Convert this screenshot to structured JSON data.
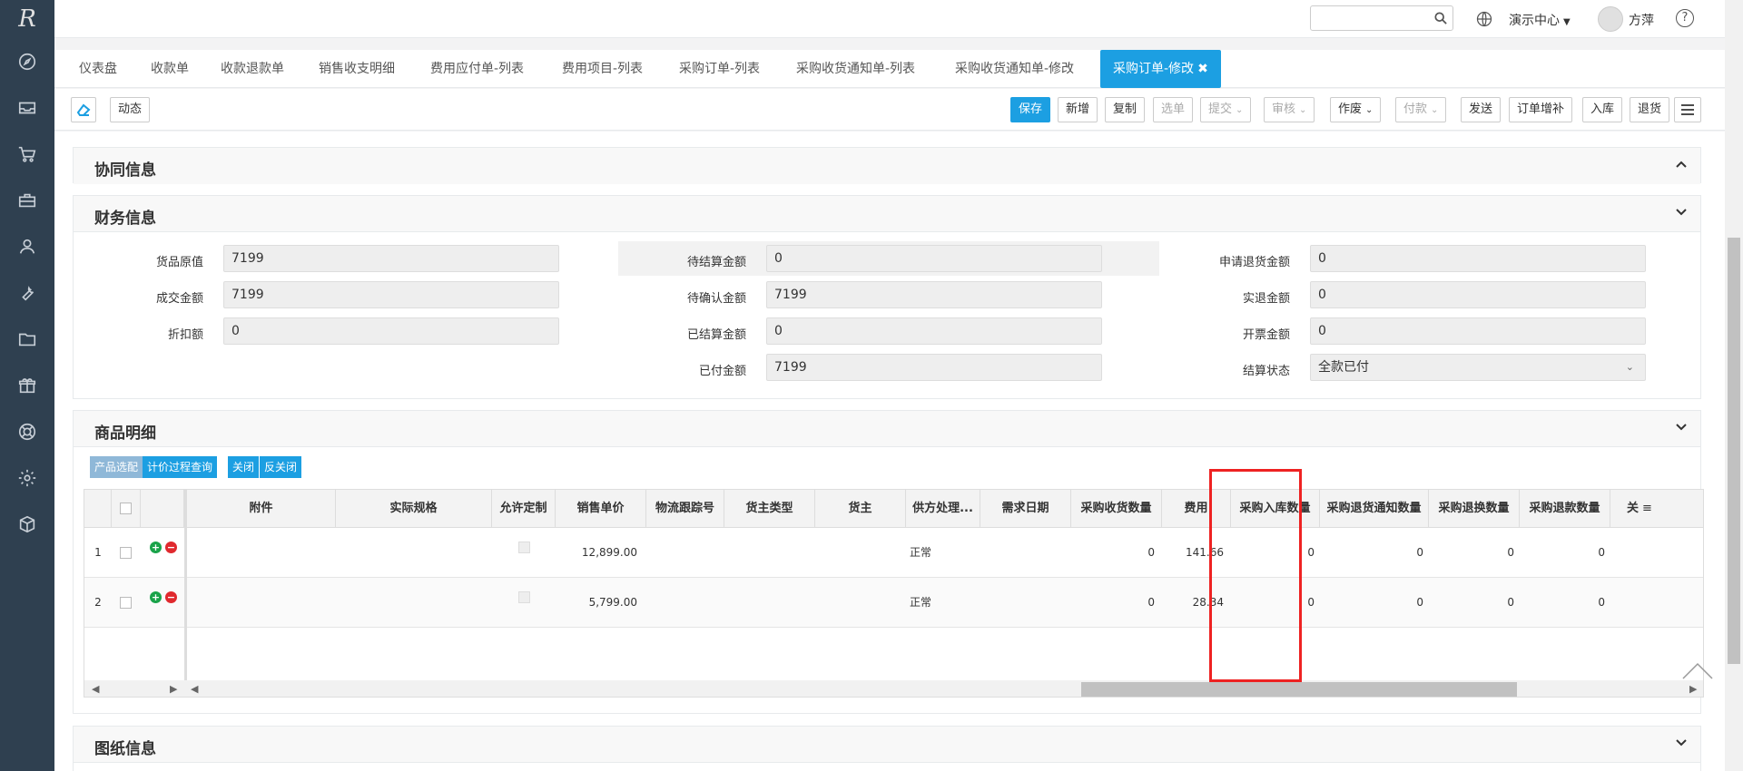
{
  "app": {
    "logo_text": "R",
    "user": "方萍",
    "center_menu": "演示中心",
    "search_placeholder": ""
  },
  "sidebar_icons": [
    "compass-icon",
    "inbox-icon",
    "cart-icon",
    "briefcase-icon",
    "user-icon",
    "wrench-icon",
    "folder-icon",
    "gift-icon",
    "lifebuoy-icon",
    "gear-icon",
    "cube-icon"
  ],
  "tabs": [
    "仪表盘",
    "收款单",
    "收款退款单",
    "销售收支明细",
    "费用应付单-列表",
    "费用项目-列表",
    "采购订单-列表",
    "采购收货通知单-列表",
    "采购收货通知单-修改",
    "采购订单-修改"
  ],
  "active_tab_index": 9,
  "toolbar": {
    "dynamic": "动态",
    "save": "保存",
    "add": "新增",
    "copy": "复制",
    "select": "选单",
    "submit": "提交",
    "audit": "审核",
    "void": "作废",
    "payment": "付款",
    "send": "发送",
    "order_supplement": "订单增补",
    "warehouse_in": "入库",
    "return": "退货"
  },
  "sections": {
    "collab": "协同信息",
    "finance": "财务信息",
    "goods": "商品明细",
    "drawings": "图纸信息"
  },
  "finance": {
    "col1": [
      {
        "label": "货品原值",
        "value": "7199"
      },
      {
        "label": "成交金额",
        "value": "7199"
      },
      {
        "label": "折扣额",
        "value": "0"
      }
    ],
    "col2": [
      {
        "label": "待结算金额",
        "value": "0"
      },
      {
        "label": "待确认金额",
        "value": "7199"
      },
      {
        "label": "已结算金额",
        "value": "0"
      },
      {
        "label": "已付金额",
        "value": "7199"
      }
    ],
    "col3": [
      {
        "label": "申请退货金额",
        "value": "0"
      },
      {
        "label": "实退金额",
        "value": "0"
      },
      {
        "label": "开票金额",
        "value": "0"
      },
      {
        "label": "结算状态",
        "value": "全款已付"
      }
    ]
  },
  "grid": {
    "buttons": [
      "产品选配",
      "计价过程查询",
      "关闭",
      "反关闭"
    ],
    "headers": [
      "附件",
      "实际规格",
      "允许定制",
      "销售单价",
      "物流跟踪号",
      "货主类型",
      "货主",
      "供方处理...",
      "需求日期",
      "采购收货数量",
      "费用",
      "采购入库数量",
      "采购退货通知数量",
      "采购退换数量",
      "采购退款数量",
      "关"
    ],
    "rows": [
      {
        "no": "1",
        "price": "12,899.00",
        "supplier_status": "正常",
        "received_qty": "0",
        "fee": "141.66",
        "in_qty": "0",
        "ret_notice_qty": "0",
        "exchange_qty": "0",
        "refund_qty": "0"
      },
      {
        "no": "2",
        "price": "5,799.00",
        "supplier_status": "正常",
        "received_qty": "0",
        "fee": "28.34",
        "in_qty": "0",
        "ret_notice_qty": "0",
        "exchange_qty": "0",
        "refund_qty": "0"
      }
    ]
  },
  "colors": {
    "primary": "#1c9fe2",
    "sidebar": "#2f4050",
    "highlight_box": "#e22222"
  }
}
